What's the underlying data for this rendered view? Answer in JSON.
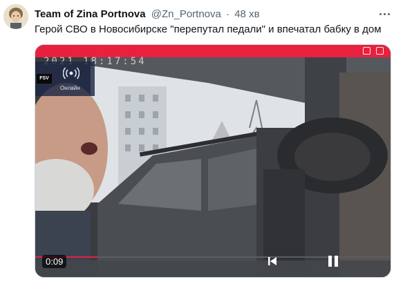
{
  "tweet": {
    "author_name": "Team of Zina Portnova",
    "handle": "@Zn_Portnova",
    "separator": "·",
    "time": "48 хв",
    "text": "Герой СВО в Новосибирске \"перепутал педали\" и впечатал бабку в дом",
    "more_icon": "ellipsis-icon"
  },
  "media": {
    "osd_timestamp": "2021 18:17:54",
    "app_logo_text": "FSV",
    "status_label": "Онлайн",
    "status_icon": "broadcast-icon",
    "video_time": "0:09",
    "controls": [
      "skip-icon",
      "pause-icon"
    ],
    "accent_color": "#e8213f"
  }
}
